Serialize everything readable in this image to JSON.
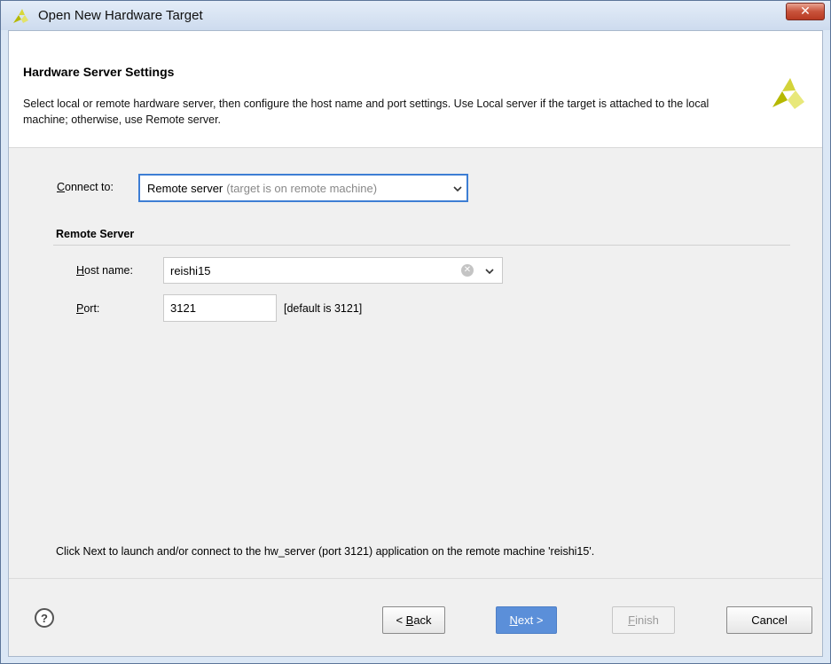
{
  "window": {
    "title": "Open New Hardware Target",
    "close_glyph": "✕"
  },
  "header": {
    "title": "Hardware Server Settings",
    "description": "Select local or remote hardware server, then configure the host name and port settings. Use Local server if the target is attached to the local machine; otherwise, use Remote server."
  },
  "connect": {
    "label_accel": "C",
    "label_rest": "onnect to:",
    "selected": "Remote server",
    "selected_hint": "(target is on remote machine)"
  },
  "remote_server": {
    "group_title": "Remote Server",
    "host_label_accel": "H",
    "host_label_rest": "ost name:",
    "host_value": "reishi15",
    "clear_glyph": "✕",
    "port_label_accel": "P",
    "port_label_rest": "ort:",
    "port_value": "3121",
    "port_default": "[default is 3121]"
  },
  "status": {
    "message": "Click Next to launch and/or connect to the hw_server (port 3121) application on the remote machine 'reishi15'."
  },
  "footer": {
    "help_glyph": "?",
    "back_prefix": "< ",
    "back_accel": "B",
    "back_rest": "ack",
    "next_accel": "N",
    "next_rest": "ext >",
    "finish_accel": "F",
    "finish_rest": "inish",
    "cancel": "Cancel"
  },
  "colors": {
    "accent_blue": "#3d7ed4",
    "next_button": "#5b8fd9",
    "close_red": "#c8533b",
    "logo_dark": "#b5b800",
    "logo_light": "#e3e36a"
  },
  "icons": [
    "app-logo-icon",
    "close-icon",
    "chevron-down-icon",
    "clear-icon",
    "help-icon"
  ]
}
